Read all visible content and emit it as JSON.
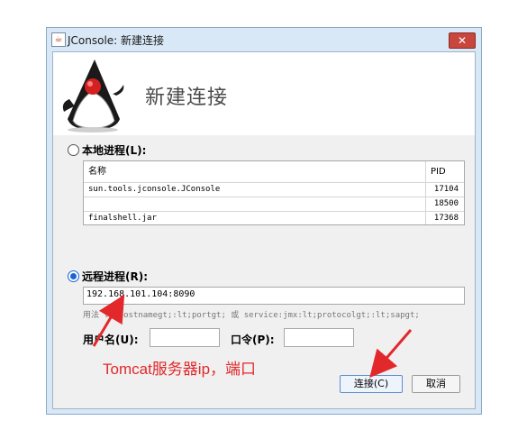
{
  "window": {
    "title": "JConsole: 新建连接",
    "close_glyph": "✕"
  },
  "banner": {
    "title": "新建连接",
    "logo_icon": "java-duke-icon"
  },
  "local": {
    "label": "本地进程(L):",
    "selected": false,
    "columns": {
      "name": "名称",
      "pid": "PID"
    },
    "rows": [
      {
        "name": "sun.tools.jconsole.JConsole",
        "pid": "17104"
      },
      {
        "name": "",
        "pid": "18500"
      },
      {
        "name": "finalshell.jar",
        "pid": "17368"
      }
    ]
  },
  "remote": {
    "label": "远程进程(R):",
    "selected": true,
    "value": "192.168.101.104:8090",
    "hint": "用法 lt;hostnamegt;:lt;portgt; 或 service:jmx:lt;protocolgt;:lt;sapgt;"
  },
  "credentials": {
    "username_label": "用户名(U):",
    "username_value": "",
    "password_label": "口令(P):",
    "password_value": ""
  },
  "buttons": {
    "connect": "连接(C)",
    "cancel": "取消"
  },
  "annotation": {
    "text": "Tomcat服务器ip，端口",
    "color": "#e2282b"
  },
  "colors": {
    "accent": "#1a64d6",
    "titlebar": "#d9e8f7",
    "close": "#c9463d"
  }
}
